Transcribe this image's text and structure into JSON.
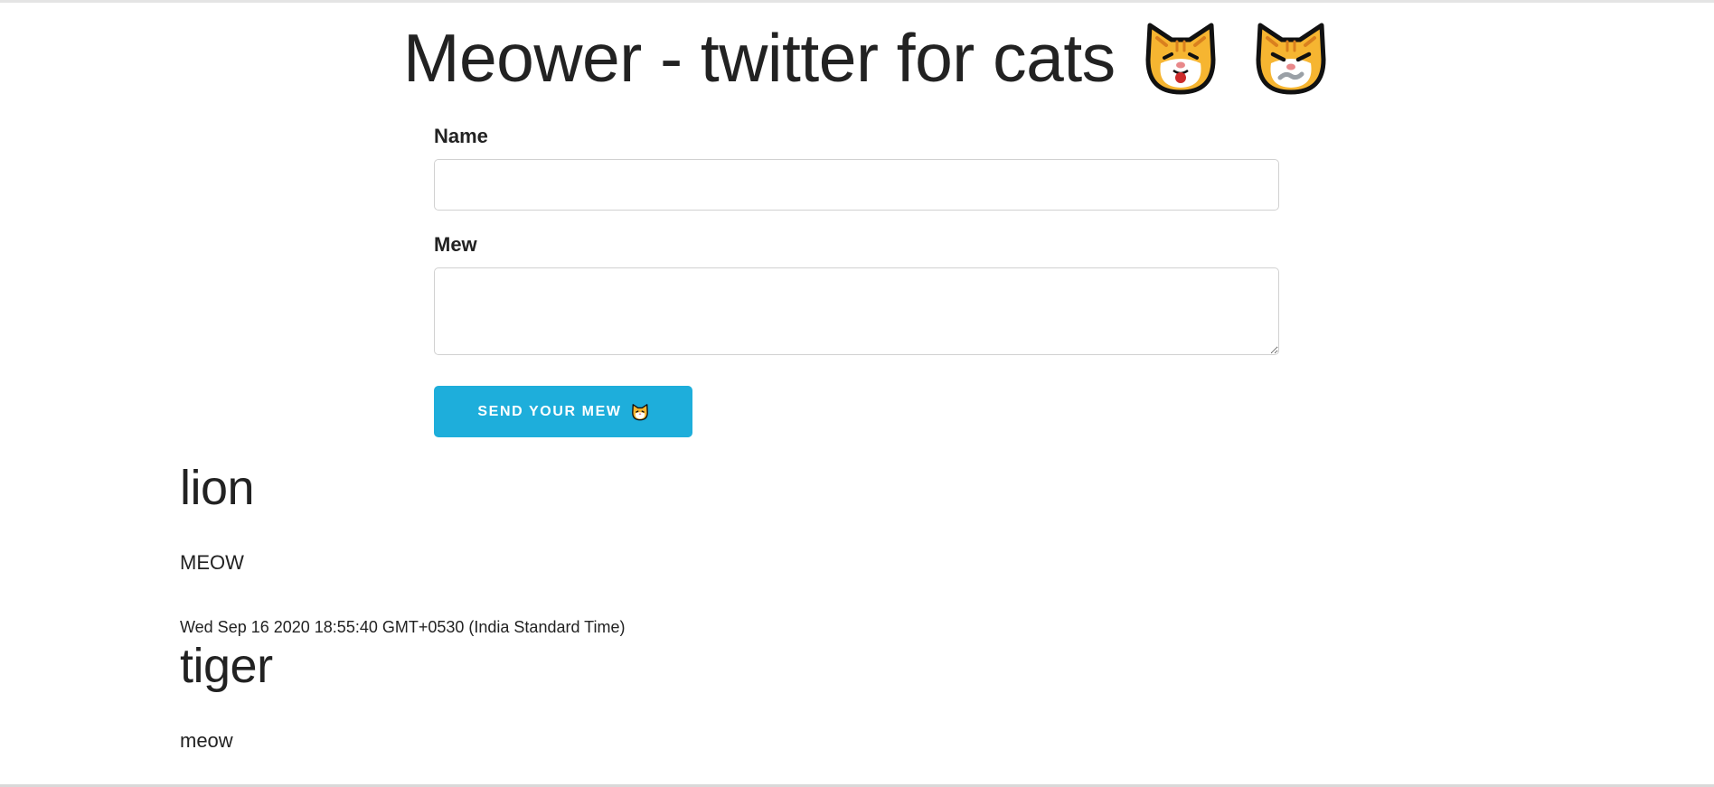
{
  "header": {
    "title": "Meower - twitter for cats",
    "icons": [
      "cat-face-icon",
      "pouting-cat-icon"
    ]
  },
  "form": {
    "name_label": "Name",
    "name_value": "",
    "mew_label": "Mew",
    "mew_value": "",
    "submit_label": "Send your mew",
    "submit_icon": "cat-face-icon"
  },
  "colors": {
    "accent": "#1eaedb",
    "cat_fill": "#f6b531",
    "cat_stripe": "#d9801e"
  },
  "mews": [
    {
      "name": "lion",
      "content": "MEOW",
      "created": "Wed Sep 16 2020 18:55:40 GMT+0530 (India Standard Time)"
    },
    {
      "name": "tiger",
      "content": "meow",
      "created": ""
    }
  ]
}
